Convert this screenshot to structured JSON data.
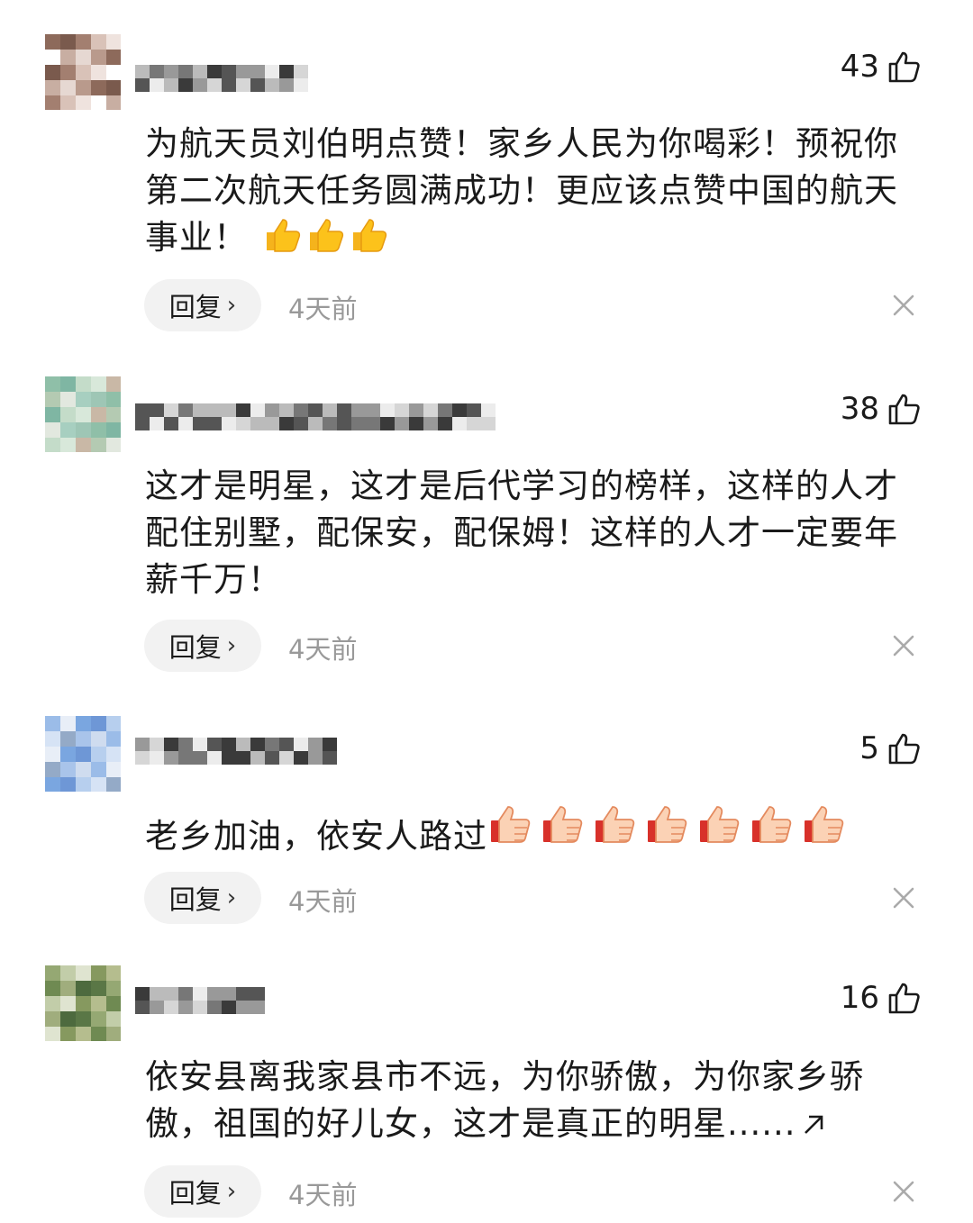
{
  "comments": [
    {
      "likes": "43",
      "text": "为航天员刘伯明点赞！家乡人民为你喝彩！预祝你第二次航天任务圆满成功！更应该点赞中国的航天事业！",
      "reply_label": "回复",
      "time": "4天前",
      "emoji": "thumbs-up-emoji-x3"
    },
    {
      "likes": "38",
      "text": "这才是明星，这才是后代学习的榜样，这样的人才配住别墅，配保安，配保姆！这样的人才一定要年薪千万！",
      "reply_label": "回复",
      "time": "4天前"
    },
    {
      "likes": "5",
      "text": "老乡加油，依安人路过",
      "reply_label": "回复",
      "time": "4天前",
      "emoji": "thumbs-up-sticker-x7"
    },
    {
      "likes": "16",
      "text": "依安县离我家县市不远，为你骄傲，为你家乡骄傲，祖国的好儿女，这才是真正的明星......",
      "reply_label": "回复",
      "time": "4天前",
      "expand_icon": "expand-arrow-icon"
    }
  ],
  "colors": {
    "text": "#1a1a1a",
    "muted": "#999999",
    "pill": "#f2f2f2"
  }
}
